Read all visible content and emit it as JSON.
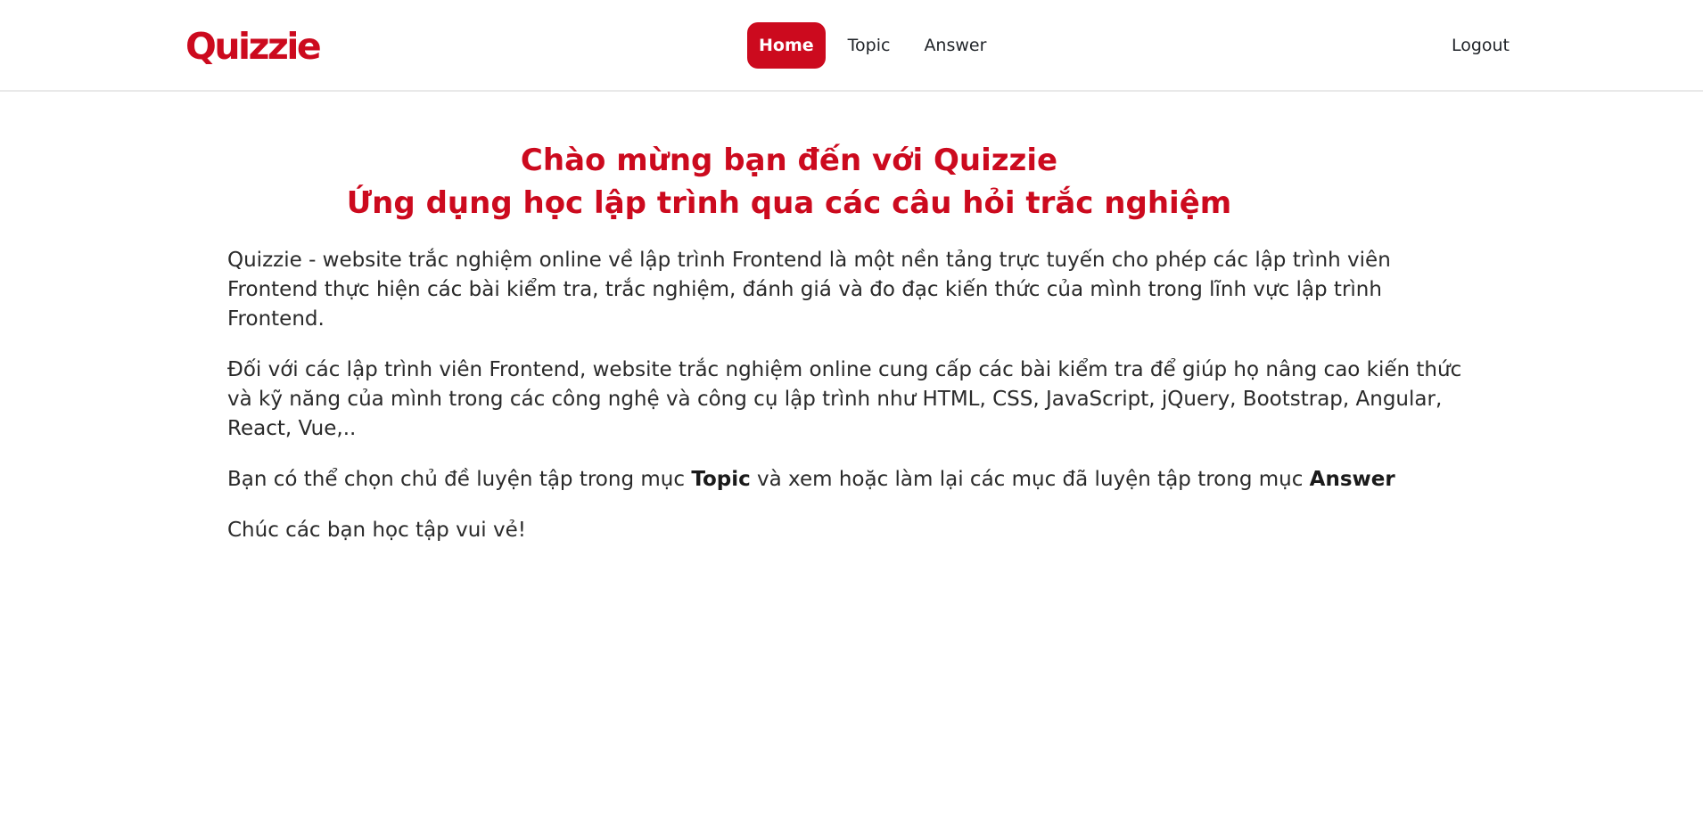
{
  "header": {
    "logo": "Quizzie",
    "nav": [
      {
        "label": "Home",
        "active": true
      },
      {
        "label": "Topic",
        "active": false
      },
      {
        "label": "Answer",
        "active": false
      }
    ],
    "logout_label": "Logout"
  },
  "main": {
    "title_line1": "Chào mừng bạn đến với Quizzie",
    "title_line2": "Ứng dụng học lập trình qua các câu hỏi trắc nghiệm",
    "paragraph1": "Quizzie - website trắc nghiệm online về lập trình Frontend là một nền tảng trực tuyến cho phép các lập trình viên Frontend thực hiện các bài kiểm tra, trắc nghiệm, đánh giá và đo đạc kiến thức của mình trong lĩnh vực lập trình Frontend.",
    "paragraph2": "Đối với các lập trình viên Frontend, website trắc nghiệm online cung cấp các bài kiểm tra để giúp họ nâng cao kiến thức và kỹ năng của mình trong các công nghệ và công cụ lập trình như HTML, CSS, JavaScript, jQuery, Bootstrap, Angular, React, Vue,..",
    "paragraph3": {
      "part1": "Bạn có thể chọn chủ đề luyện tập trong mục ",
      "topic": "Topic",
      "part2": " và xem hoặc làm lại các mục đã luyện tập trong mục ",
      "answer": "Answer"
    },
    "paragraph4": "Chúc các bạn học tập vui vẻ!"
  },
  "colors": {
    "brand": "#cc0a1e",
    "text": "#1f2328"
  }
}
